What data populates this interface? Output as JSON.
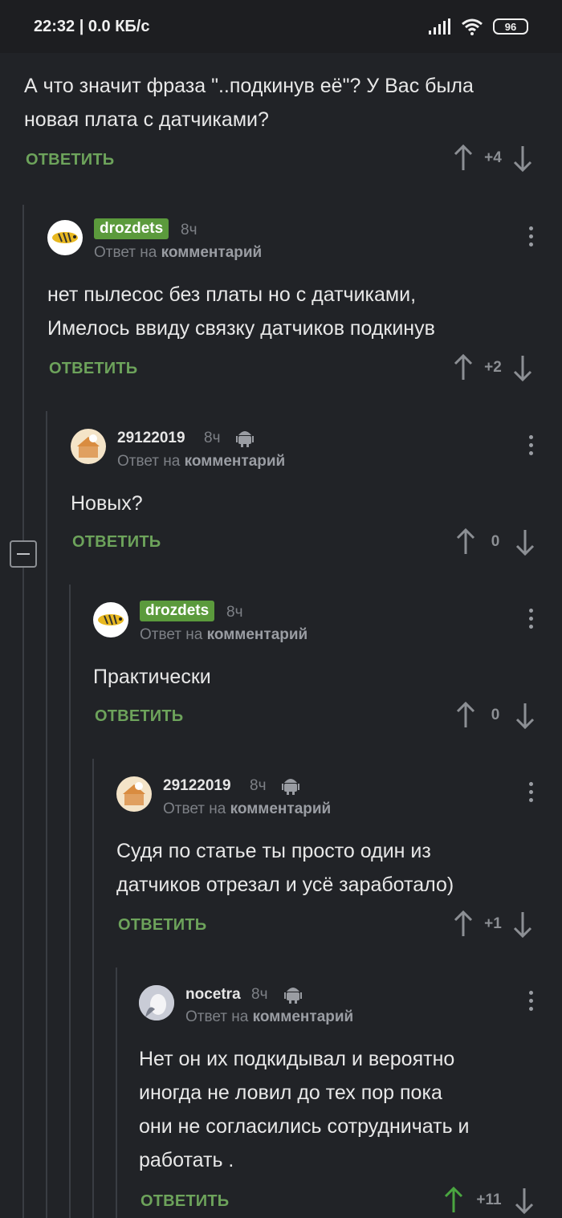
{
  "status_bar": {
    "time_speed": "22:32 | 0.0 КБ/с",
    "battery": "96"
  },
  "colors": {
    "background": "#212327",
    "accent_green": "#6da35b",
    "badge_green": "#5b9a3c",
    "upvoted": "#4aa640"
  },
  "reply_label": "ОТВЕТИТЬ",
  "reply_to_prefix": "Ответ на",
  "reply_to_target": "комментарий",
  "comments": [
    {
      "text_lines": [
        "А что значит фраза \"..подкинув её\"? У Вас была",
        "новая плата с датчиками?"
      ],
      "score": "+4"
    },
    {
      "author": "drozdets",
      "time": "8ч",
      "text_lines": [
        "нет пылесос без платы но с датчиками,",
        "Имелось ввиду связку датчиков подкинув"
      ],
      "score": "+2"
    },
    {
      "author": "29122019",
      "time": "8ч",
      "platform_icon": "android-icon",
      "text_lines": [
        "Новых?"
      ],
      "score": "0"
    },
    {
      "author": "drozdets",
      "time": "8ч",
      "text_lines": [
        "Практически"
      ],
      "score": "0"
    },
    {
      "author": "29122019",
      "time": "8ч",
      "platform_icon": "android-icon",
      "text_lines": [
        "Судя по статье ты просто один из",
        "датчиков отрезал и усё заработало)"
      ],
      "score": "+1"
    },
    {
      "author": "nocetra",
      "time": "8ч",
      "platform_icon": "android-icon",
      "text_lines": [
        "Нет он их подкидывал и вероятно",
        "иногда не ловил до тех пор пока",
        "они не согласились сотрудничать и",
        "работать ."
      ],
      "score": "+11"
    }
  ]
}
